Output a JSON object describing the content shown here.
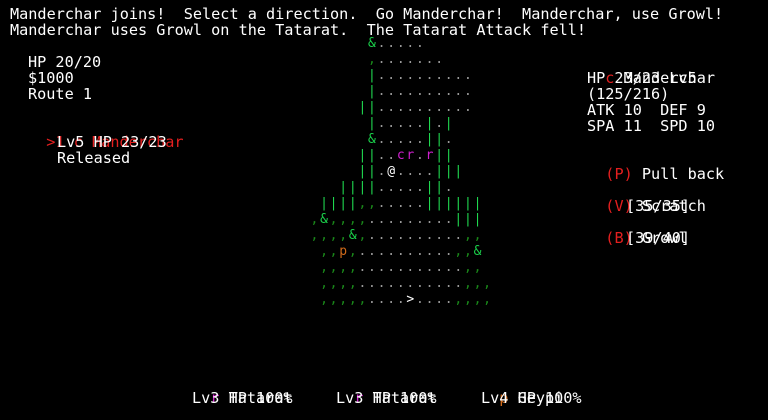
{
  "messages": [
    "Manderchar joins!  Select a direction.  Go Manderchar!  Manderchar, use Growl!",
    "Manderchar uses Growl on the Tatarat.  The Tatarat Attack fell!"
  ],
  "player": {
    "hp": "HP 20/20",
    "money": "$1000",
    "location": "Route 1"
  },
  "party": [
    {
      "cursor": ">1",
      "glyph": "c",
      "name": "Manderchar",
      "level_hp": "Lv5 HP 23/23",
      "status": "Released"
    }
  ],
  "active": {
    "glyph": "c",
    "name": "Manderchar",
    "hp_level": "HP 23/23 Lv5",
    "exp": "(125/216)",
    "atk_def": "ATK 10  DEF 9",
    "spa_spd": "SPA 11  SPD 10"
  },
  "actions": [
    {
      "key": "(P)",
      "label": "Pull back",
      "pp": ""
    },
    {
      "key": "(V)",
      "label": "Scratch",
      "pp": "[35/35]"
    },
    {
      "key": "(B)",
      "label": "Growl",
      "pp": "[39/40]"
    }
  ],
  "enemies": [
    {
      "glyph": "r",
      "name": "Tatarat",
      "info": "Lv3 HP 100%"
    },
    {
      "glyph": "r",
      "name": "Tatarat",
      "info": "Lv3 HP 100%"
    },
    {
      "glyph": "p",
      "name": "Geypi",
      "info": "Lv4 HP 100%"
    }
  ],
  "colors": {
    "red": "#e41f1f",
    "magenta": "#d01fd0",
    "orange": "#d06a1a",
    "green": "#1fd84f",
    "darkgreen": "#1a8a1a",
    "text": "#ffffff",
    "background": "#000000"
  },
  "map_rows": [
    "       &.....        ",
    "       ,.......      ",
    "       |..........   ",
    "       |..........   ",
    "      ||..........   ",
    "       |.....|.|     ",
    "       &.....||.     ",
    "      ||..cr.r||     ",
    "      ||.@....|||    ",
    "    ||||.....||.     ",
    "  ||||,,.....||||||  ",
    " ,&,,,,.........|||  ",
    " ,,,,&,..........,,  ",
    "  ,,p,..........,,&  ",
    "  ,,,,...........,,  ",
    "  ,,,,...........,,, ",
    "  ,,,,,....>....,,,, "
  ]
}
